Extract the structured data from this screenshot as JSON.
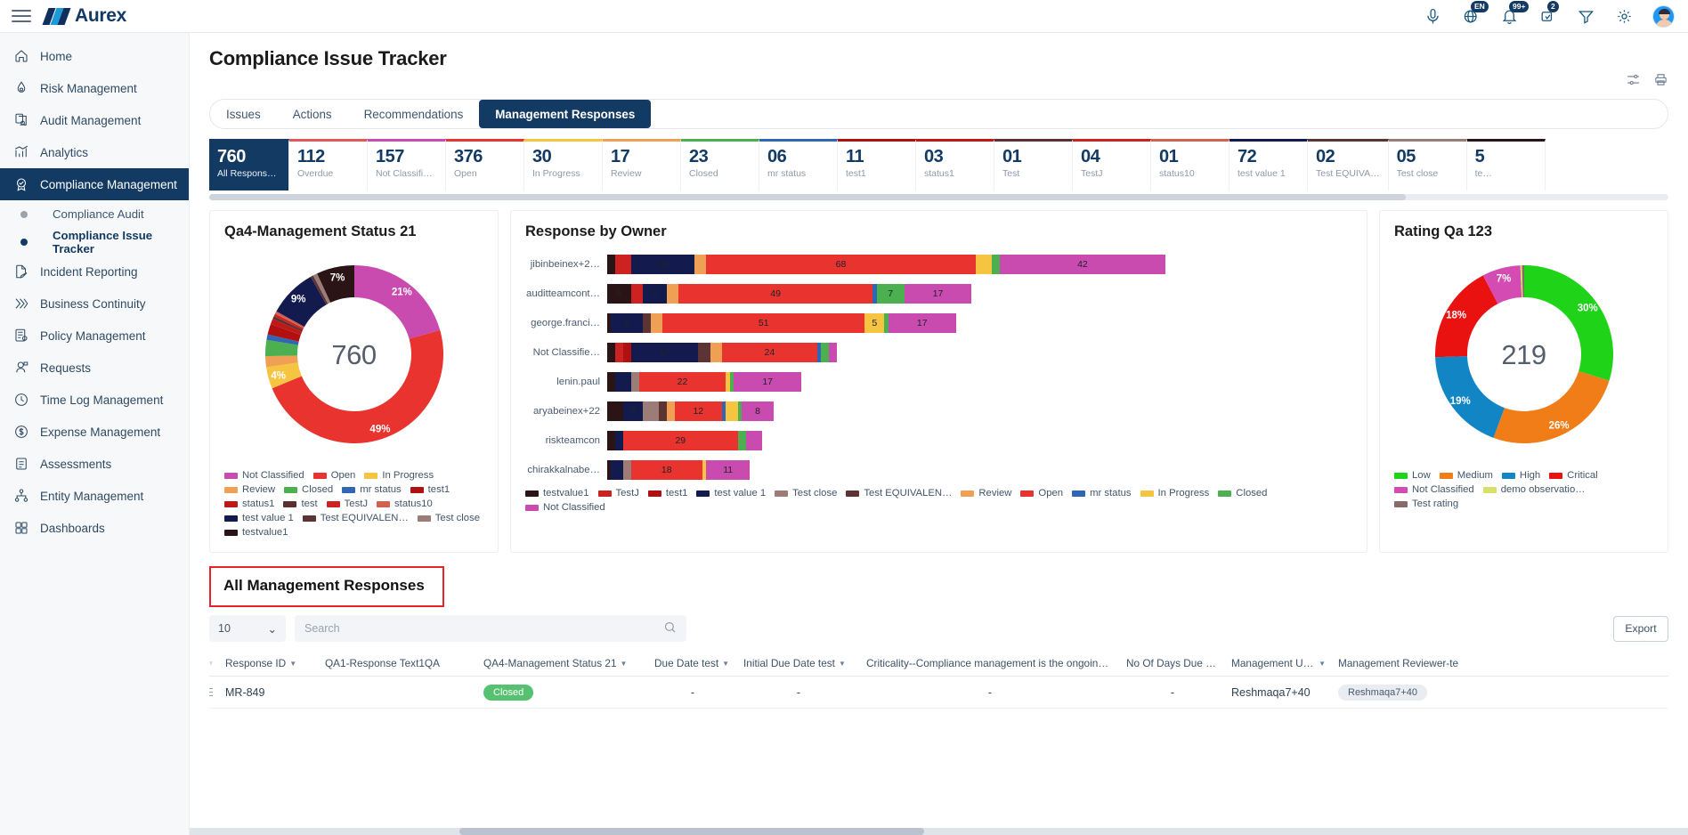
{
  "app": {
    "brand": "Aurex",
    "lang_badge": "EN",
    "notif_badge": "99+",
    "task_badge": "2"
  },
  "sidebar": {
    "items": [
      {
        "label": "Home",
        "icon": "home-icon",
        "active": false
      },
      {
        "label": "Risk Management",
        "icon": "risk-icon",
        "active": false
      },
      {
        "label": "Audit Management",
        "icon": "audit-icon",
        "active": false
      },
      {
        "label": "Analytics",
        "icon": "analytics-icon",
        "active": false
      },
      {
        "label": "Compliance Management",
        "icon": "compliance-icon",
        "active": true
      }
    ],
    "sub_items": [
      {
        "label": "Compliance Audit",
        "selected": false
      },
      {
        "label": "Compliance Issue Tracker",
        "selected": true
      }
    ],
    "items_after": [
      {
        "label": "Incident Reporting",
        "icon": "incident-icon"
      },
      {
        "label": "Business Continuity",
        "icon": "continuity-icon"
      },
      {
        "label": "Policy Management",
        "icon": "policy-icon"
      },
      {
        "label": "Requests",
        "icon": "requests-icon"
      },
      {
        "label": "Time Log Management",
        "icon": "clock-icon"
      },
      {
        "label": "Expense Management",
        "icon": "dollar-icon"
      },
      {
        "label": "Assessments",
        "icon": "assessment-icon"
      },
      {
        "label": "Entity Management",
        "icon": "entity-icon"
      },
      {
        "label": "Dashboards",
        "icon": "dashboard-icon"
      }
    ]
  },
  "page": {
    "title": "Compliance Issue Tracker",
    "tabs": [
      {
        "label": "Issues",
        "active": false
      },
      {
        "label": "Actions",
        "active": false
      },
      {
        "label": "Recommendations",
        "active": false
      },
      {
        "label": "Management Responses",
        "active": true
      }
    ]
  },
  "kpis": [
    {
      "value": "760",
      "label": "All Respons…",
      "color": "#123a63",
      "selected": true
    },
    {
      "value": "112",
      "label": "Overdue",
      "color": "#e2575c",
      "selected": false
    },
    {
      "value": "157",
      "label": "Not Classifi…",
      "color": "#c94bb0",
      "selected": false
    },
    {
      "value": "376",
      "label": "Open",
      "color": "#e8332f",
      "selected": false
    },
    {
      "value": "30",
      "label": "In Progress",
      "color": "#f5c542",
      "selected": false
    },
    {
      "value": "17",
      "label": "Review",
      "color": "#f0a055",
      "selected": false
    },
    {
      "value": "23",
      "label": "Closed",
      "color": "#4caf50",
      "selected": false
    },
    {
      "value": "06",
      "label": "mr status",
      "color": "#2f67b5",
      "selected": false
    },
    {
      "value": "11",
      "label": "test1",
      "color": "#b01010",
      "selected": false
    },
    {
      "value": "03",
      "label": "status1",
      "color": "#c01717",
      "selected": false
    },
    {
      "value": "01",
      "label": "Test",
      "color": "#5a3030",
      "selected": false
    },
    {
      "value": "04",
      "label": "TestJ",
      "color": "#cc2222",
      "selected": false
    },
    {
      "value": "01",
      "label": "status10",
      "color": "#d4604f",
      "selected": false
    },
    {
      "value": "72",
      "label": "test value 1",
      "color": "#131a4d",
      "selected": false
    },
    {
      "value": "02",
      "label": "Test EQUIVA…",
      "color": "#5c3434",
      "selected": false
    },
    {
      "value": "05",
      "label": "Test close",
      "color": "#9b7c76",
      "selected": false
    },
    {
      "value": "5",
      "label": "te…",
      "color": "#2b1416",
      "selected": false
    }
  ],
  "chart_data": [
    {
      "type": "pie",
      "title": "Qa4-Management Status 21",
      "center_value": "760",
      "categories": [
        "Not Classified",
        "Open",
        "In Progress",
        "Review",
        "Closed",
        "mr status",
        "test1",
        "status1",
        "test",
        "TestJ",
        "status10",
        "test value 1",
        "Test EQUIVALEN…",
        "Test close",
        "testvalue1"
      ],
      "values": [
        21,
        49,
        4,
        2,
        3,
        1,
        2,
        1,
        0.5,
        0.5,
        0.5,
        9,
        0.5,
        0.8,
        7
      ],
      "labels_shown": [
        {
          "text": "21%",
          "cat": "Not Classified"
        },
        {
          "text": "49%",
          "cat": "Open"
        },
        {
          "text": "4%",
          "cat": "In Progress"
        },
        {
          "text": "9%",
          "cat": "test value 1"
        },
        {
          "text": "7%",
          "cat": "testvalue1"
        }
      ],
      "colors": [
        "#c94bb0",
        "#e8332f",
        "#f5c542",
        "#f0a055",
        "#4caf50",
        "#2f67b5",
        "#b01010",
        "#c01717",
        "#5a3030",
        "#cc2222",
        "#d4604f",
        "#131a4d",
        "#5c3434",
        "#9b7c76",
        "#2b1416"
      ],
      "legend_position": "bottom"
    },
    {
      "type": "bar",
      "title": "Response by Owner",
      "orientation": "horizontal",
      "stacked": true,
      "categories": [
        "jibinbeinex+2…",
        "auditteamcont…",
        "george.franci…",
        "Not Classifie…",
        "lenin.paul",
        "aryabeinex+22",
        "riskteamcon",
        "chirakkalnabe…"
      ],
      "series": [
        {
          "name": "testvalue1",
          "color": "#2b1416",
          "values": [
            2,
            6,
            1,
            2,
            2,
            4,
            2,
            1
          ]
        },
        {
          "name": "TestJ",
          "color": "#cc2222",
          "values": [
            4,
            3,
            0,
            2,
            0,
            0,
            0,
            0
          ]
        },
        {
          "name": "test1",
          "color": "#b01010",
          "values": [
            0,
            0,
            0,
            2,
            0,
            0,
            0,
            0
          ]
        },
        {
          "name": "test value 1",
          "color": "#131a4d",
          "values": [
            16,
            6,
            8,
            17,
            4,
            5,
            2,
            3
          ]
        },
        {
          "name": "Test close",
          "color": "#9b7c76",
          "values": [
            0,
            0,
            0,
            0,
            2,
            4,
            0,
            2
          ]
        },
        {
          "name": "Test EQUIVALEN…",
          "color": "#5c3434",
          "values": [
            0,
            0,
            2,
            3,
            0,
            2,
            0,
            0
          ]
        },
        {
          "name": "Review",
          "color": "#f0a055",
          "values": [
            3,
            3,
            3,
            3,
            0,
            2,
            0,
            0
          ]
        },
        {
          "name": "Open",
          "color": "#e8332f",
          "values": [
            68,
            49,
            51,
            24,
            22,
            12,
            29,
            18
          ]
        },
        {
          "name": "mr status",
          "color": "#2f67b5",
          "values": [
            0,
            1,
            0,
            1,
            0,
            1,
            0,
            0
          ]
        },
        {
          "name": "In Progress",
          "color": "#f5c542",
          "values": [
            4,
            0,
            5,
            0,
            1,
            3,
            0,
            1
          ]
        },
        {
          "name": "Closed",
          "color": "#4caf50",
          "values": [
            2,
            7,
            1,
            2,
            1,
            1,
            2,
            0
          ]
        },
        {
          "name": "Not Classified",
          "color": "#c94bb0",
          "values": [
            42,
            17,
            17,
            2,
            17,
            8,
            4,
            11
          ]
        }
      ],
      "value_labels_visible": {
        "jibinbeinex+2…": [
          "4",
          "16",
          "68",
          "4"
        ],
        "auditteamcont…": [
          "6",
          "3",
          "6",
          "3",
          "49",
          "7",
          "17"
        ],
        "george.franci…": [
          "8",
          "51",
          "5",
          "17"
        ],
        "Not Classifie…": [
          "17",
          "24"
        ],
        "lenin.paul": [
          "4",
          "22",
          "17"
        ],
        "aryabeinex+22": [
          "5",
          "4",
          "12",
          "3",
          "8"
        ],
        "riskteamcon": [
          "29",
          "4"
        ],
        "chirakkalnabe…": [
          "3",
          "18",
          "11"
        ]
      },
      "legend_position": "bottom"
    },
    {
      "type": "pie",
      "title": "Rating Qa 123",
      "center_value": "219",
      "categories": [
        "Low",
        "Medium",
        "High",
        "Critical",
        "Not Classified",
        "demo observatio…",
        "Test rating"
      ],
      "values": [
        30,
        26,
        19,
        18,
        7,
        0.3,
        0.4
      ],
      "labels_shown": [
        {
          "text": "30%",
          "cat": "Low"
        },
        {
          "text": "26%",
          "cat": "Medium"
        },
        {
          "text": "19%",
          "cat": "High"
        },
        {
          "text": "18%",
          "cat": "Critical"
        },
        {
          "text": "7%",
          "cat": "Not Classified"
        }
      ],
      "colors": [
        "#1ed318",
        "#f07d18",
        "#1285c4",
        "#ea1111",
        "#d44bb4",
        "#d8e06a",
        "#8a6a66"
      ],
      "legend_position": "bottom"
    }
  ],
  "table": {
    "title": "All Management Responses",
    "page_size": "10",
    "search_placeholder": "Search",
    "export_label": "Export",
    "columns": [
      {
        "label": "Response ID",
        "sortable": true
      },
      {
        "label": "QA1-Response Text1QA",
        "sortable": false
      },
      {
        "label": "QA4-Management Status 21",
        "sortable": true
      },
      {
        "label": "Due Date test",
        "sortable": true
      },
      {
        "label": "Initial Due Date  test",
        "sortable": true
      },
      {
        "label": "Criticality--Compliance management is the ongoing …",
        "sortable": false
      },
      {
        "label": "No Of Days Due am",
        "sortable": false
      },
      {
        "label": "Management User  test",
        "sortable": true
      },
      {
        "label": "Management Reviewer-te",
        "sortable": false
      }
    ],
    "rows": [
      {
        "response_id": "MR-849",
        "qa1_response_text": "",
        "status": "Closed",
        "due_date": "-",
        "initial_due_date": "-",
        "criticality": "-",
        "days_due": "-",
        "management_user": "Reshmaqa7+40",
        "management_reviewer": "Reshmaqa7+40"
      }
    ]
  }
}
